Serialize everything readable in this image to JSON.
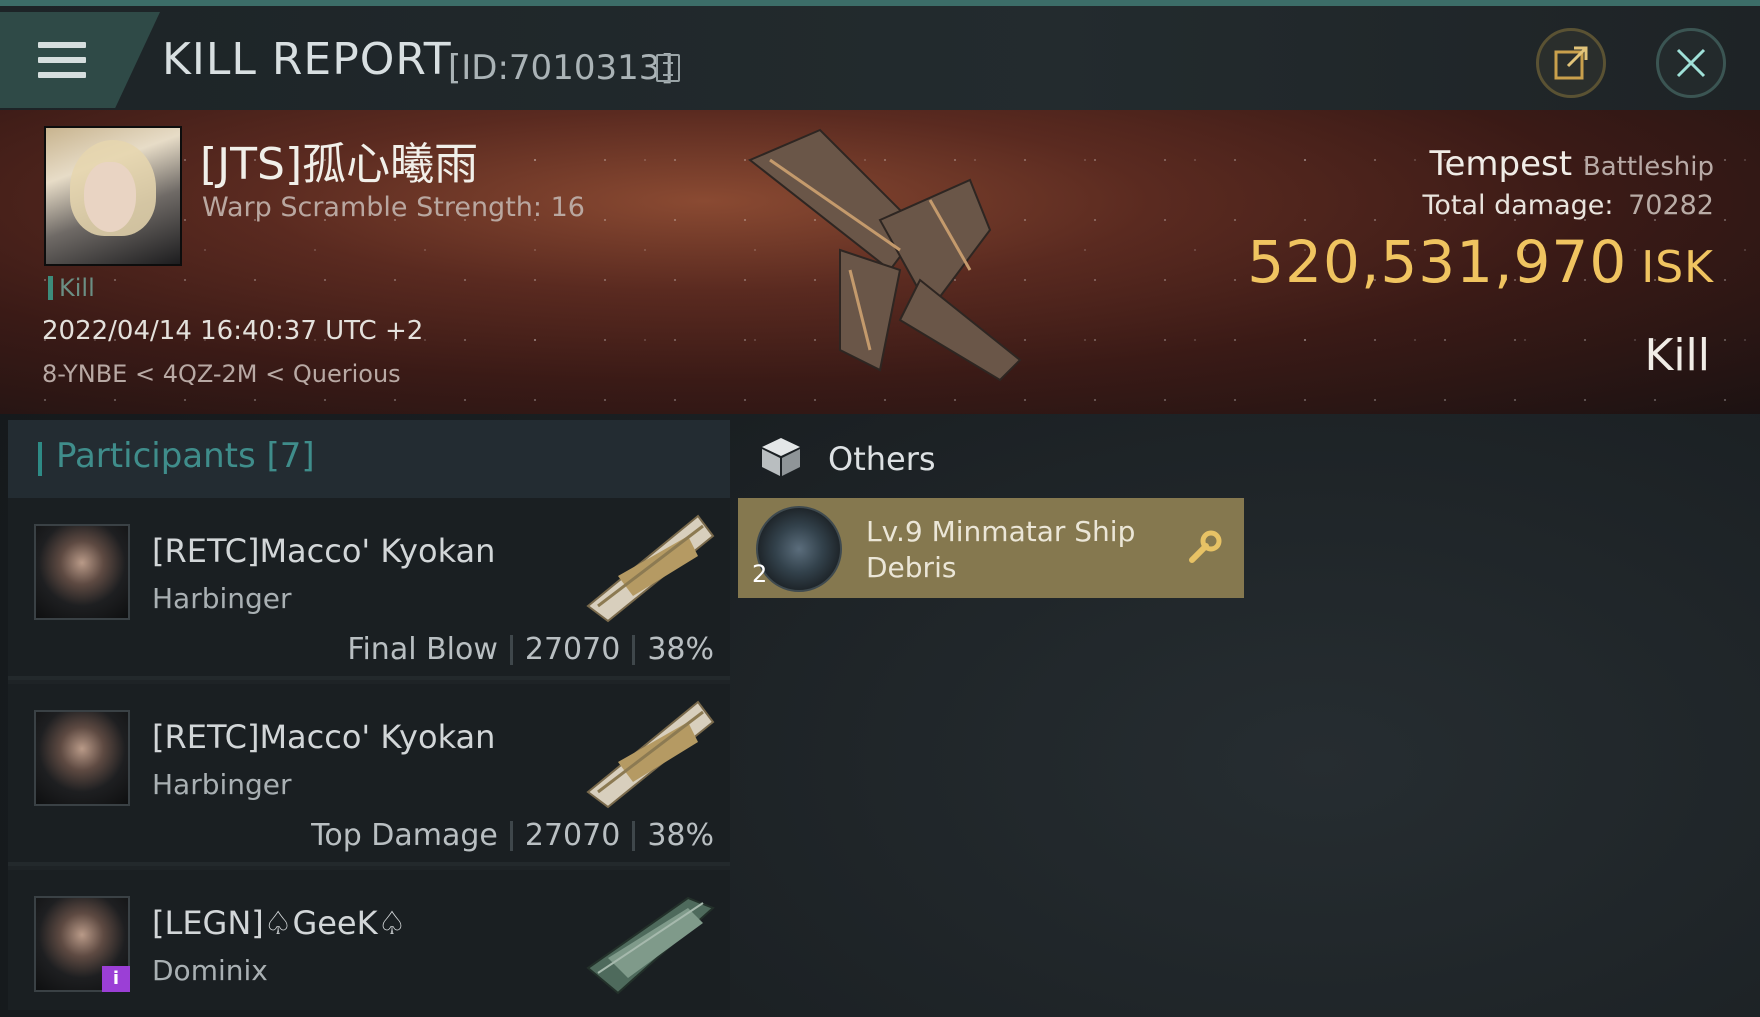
{
  "header": {
    "title": "KILL REPORT",
    "report_id": "[ID:7010313]"
  },
  "victim": {
    "name": "[JTS]孤心曦雨",
    "detail": "Warp Scramble Strength: 16",
    "tag": "Kill",
    "datetime": "2022/04/14 16:40:37 UTC +2",
    "location": "8-YNBE < 4QZ-2M < Querious",
    "ship_name": "Tempest",
    "ship_class": "Battleship",
    "total_damage_label": "Total damage:",
    "total_damage": "70282",
    "isk_value": "520,531,970",
    "isk_unit": "ISK",
    "result": "Kill"
  },
  "participants": {
    "title": "Participants [7]",
    "rows": [
      {
        "name": "[RETC]Macco' Kyokan",
        "ship": "Harbinger",
        "role": "Final Blow",
        "damage": "27070",
        "percent": "38%"
      },
      {
        "name": "[RETC]Macco' Kyokan",
        "ship": "Harbinger",
        "role": "Top Damage",
        "damage": "27070",
        "percent": "38%"
      },
      {
        "name": "[LEGN]♤GeeK♤",
        "ship": "Dominix",
        "badge": "i"
      }
    ]
  },
  "others": {
    "title": "Others",
    "item": {
      "name": "Lv.9 Minmatar Ship Debris",
      "qty": "2"
    }
  },
  "colors": {
    "accent_teal": "#3f8d8b",
    "isk_gold": "#f0c460",
    "item_card": "#85784f"
  },
  "icons": [
    "menu-icon",
    "copy-icon",
    "share-icon",
    "close-icon",
    "cube-icon",
    "wrench-icon"
  ]
}
